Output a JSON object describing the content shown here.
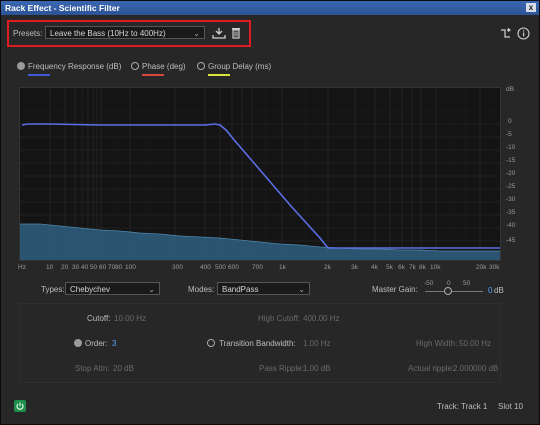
{
  "window": {
    "title": "Rack Effect - Scientific Filter",
    "close": "x"
  },
  "presets": {
    "label": "Presets:",
    "value": "Leave the Bass (10Hz to 400Hz)"
  },
  "legend": {
    "frequency": "Frequency Response (dB)",
    "phase": "Phase (deg)",
    "group_delay": "Group Delay (ms)"
  },
  "colors": {
    "frequency": "#3f5bd6",
    "phase": "#d9463f",
    "group_delay": "#d8e23c",
    "accent": "#5aa0ff"
  },
  "graph": {
    "db_labels": [
      "dB",
      "0",
      "-5",
      "-10",
      "-15",
      "-20",
      "-25",
      "-30",
      "-35",
      "-40",
      "-45"
    ],
    "freq_labels": [
      "Hz",
      "10",
      "20",
      "30",
      "40",
      "50",
      "60",
      "70",
      "80",
      "100",
      "300",
      "400",
      "500",
      "600",
      "700",
      "1k",
      "2k",
      "3k",
      "4k",
      "5k",
      "6k",
      "7k",
      "8k",
      "10k",
      "20k",
      "30k"
    ]
  },
  "controls": {
    "types_label": "Types:",
    "types_value": "Chebychev",
    "modes_label": "Modes:",
    "modes_value": "BandPass",
    "master_gain_label": "Master Gain:",
    "gain_ticks": [
      "-50",
      "0",
      "50"
    ],
    "gain_value": "0",
    "gain_unit": "dB"
  },
  "params": {
    "cutoff_label": "Cutoff:",
    "cutoff_value": "10.00 Hz",
    "high_cutoff_label": "High Cutoff:",
    "high_cutoff_value": "400.00 Hz",
    "order_label": "Order:",
    "order_value": "3",
    "transition_label": "Transition Bandwidth:",
    "transition_value": "1.00 Hz",
    "high_width_label": "High Width:",
    "high_width_value": "50.00 Hz",
    "stop_attn_label": "Stop Attn:",
    "stop_attn_value": "20 dB",
    "pass_ripple_label": "Pass Ripple:",
    "pass_ripple_value": "1.00 dB",
    "actual_ripple_label": "Actual ripple:",
    "actual_ripple_value": "2.000000 dB"
  },
  "status": {
    "track": "Track: Track 1",
    "slot": "Slot 10"
  }
}
